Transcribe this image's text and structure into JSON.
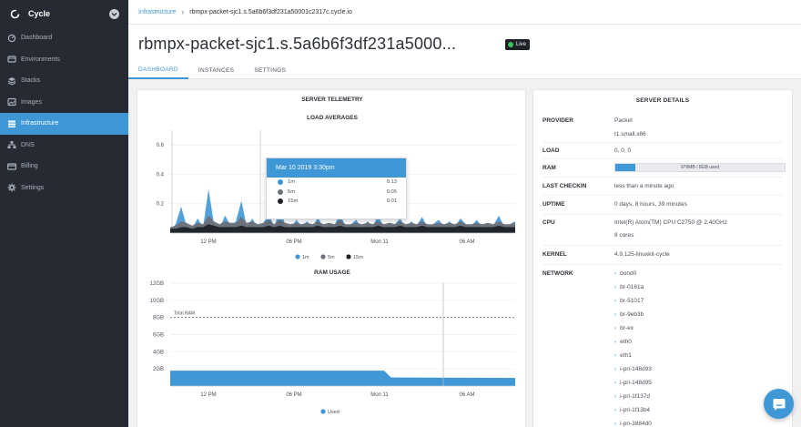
{
  "app": {
    "brand": "Cycle"
  },
  "sidebar": {
    "items": [
      {
        "label": "Dashboard",
        "icon": "dashboard-icon"
      },
      {
        "label": "Environments",
        "icon": "environments-icon"
      },
      {
        "label": "Stacks",
        "icon": "stacks-icon"
      },
      {
        "label": "Images",
        "icon": "images-icon"
      },
      {
        "label": "Infrastructure",
        "icon": "infrastructure-icon",
        "active": true
      },
      {
        "label": "DNS",
        "icon": "dns-icon"
      },
      {
        "label": "Billing",
        "icon": "billing-icon"
      },
      {
        "label": "Settings",
        "icon": "settings-icon"
      }
    ]
  },
  "breadcrumb": {
    "parent": "Infrastructure",
    "current": "rbmpx-packet-sjc1.s.5a6b6f3df231a50001c2317c.cycle.io"
  },
  "header": {
    "title": "rbmpx-packet-sjc1.s.5a6b6f3df231a5000...",
    "badge": "Live"
  },
  "tabs": [
    {
      "label": "DASHBOARD",
      "active": true
    },
    {
      "label": "INSTANCES"
    },
    {
      "label": "SETTINGS"
    }
  ],
  "telemetry": {
    "title": "SERVER TELEMETRY",
    "tooltip": {
      "title": "Mar 10 2019 3:30pm",
      "rows": [
        {
          "label": "1m",
          "value": "0.13",
          "color": "#3f97d6"
        },
        {
          "label": "5m",
          "value": "0.05",
          "color": "#6b7079"
        },
        {
          "label": "15m",
          "value": "0.01",
          "color": "#1e2128"
        }
      ]
    }
  },
  "chart_data": [
    {
      "type": "area",
      "title": "LOAD AVERAGES",
      "x_ticks": [
        "12 PM",
        "06 PM",
        "Mon 11",
        "06 AM"
      ],
      "y_ticks": [
        "0.2",
        "0.4",
        "0.6"
      ],
      "ylim": [
        0,
        0.7
      ],
      "legend": [
        "1m",
        "5m",
        "15m"
      ],
      "legend_position": "bottom",
      "colors": {
        "1m": "#3f97d6",
        "5m": "#6b7079",
        "15m": "#1e2128"
      },
      "series": [
        {
          "name": "1m",
          "values": [
            0.02,
            0.06,
            0.18,
            0.05,
            0.03,
            0.1,
            0.04,
            0.3,
            0.06,
            0.03,
            0.12,
            0.05,
            0.08,
            0.22,
            0.04,
            0.1,
            0.03,
            0.07,
            0.13,
            0.04,
            0.16,
            0.06,
            0.03,
            0.09,
            0.05,
            0.08,
            0.04,
            0.11,
            0.03,
            0.07,
            0.05,
            0.14,
            0.04,
            0.06,
            0.09,
            0.03,
            0.08,
            0.05,
            0.12,
            0.04,
            0.07,
            0.06,
            0.1,
            0.03,
            0.08,
            0.05,
            0.11,
            0.04,
            0.06,
            0.09,
            0.05,
            0.08,
            0.04,
            0.1,
            0.06,
            0.05,
            0.09,
            0.04,
            0.07,
            0.05,
            0.12,
            0.04,
            0.06,
            0.08
          ]
        },
        {
          "name": "5m",
          "values": [
            0.04,
            0.05,
            0.08,
            0.07,
            0.05,
            0.07,
            0.06,
            0.12,
            0.08,
            0.06,
            0.08,
            0.07,
            0.07,
            0.11,
            0.07,
            0.08,
            0.06,
            0.07,
            0.09,
            0.06,
            0.09,
            0.07,
            0.06,
            0.07,
            0.06,
            0.07,
            0.06,
            0.08,
            0.06,
            0.07,
            0.06,
            0.09,
            0.06,
            0.06,
            0.07,
            0.06,
            0.07,
            0.06,
            0.08,
            0.06,
            0.07,
            0.06,
            0.08,
            0.06,
            0.07,
            0.06,
            0.08,
            0.06,
            0.06,
            0.07,
            0.06,
            0.07,
            0.06,
            0.08,
            0.06,
            0.06,
            0.07,
            0.06,
            0.07,
            0.06,
            0.08,
            0.06,
            0.06,
            0.07
          ]
        },
        {
          "name": "15m",
          "values": [
            0.03,
            0.03,
            0.04,
            0.04,
            0.03,
            0.04,
            0.04,
            0.06,
            0.05,
            0.04,
            0.04,
            0.04,
            0.04,
            0.05,
            0.04,
            0.04,
            0.04,
            0.04,
            0.05,
            0.04,
            0.05,
            0.04,
            0.04,
            0.04,
            0.04,
            0.04,
            0.04,
            0.05,
            0.04,
            0.04,
            0.04,
            0.05,
            0.04,
            0.04,
            0.04,
            0.04,
            0.04,
            0.04,
            0.05,
            0.04,
            0.04,
            0.04,
            0.05,
            0.04,
            0.04,
            0.04,
            0.05,
            0.04,
            0.04,
            0.04,
            0.04,
            0.04,
            0.04,
            0.05,
            0.04,
            0.04,
            0.04,
            0.04,
            0.04,
            0.04,
            0.05,
            0.04,
            0.04,
            0.04
          ]
        }
      ]
    },
    {
      "type": "area",
      "title": "RAM USAGE",
      "x_ticks": [
        "12 PM",
        "06 PM",
        "Mon 11",
        "06 AM"
      ],
      "y_ticks": [
        "2GB",
        "4GB",
        "6GB",
        "8GB",
        "10GB",
        "12GB"
      ],
      "ylim": [
        0,
        12
      ],
      "reference_line": {
        "label": "Total RAM",
        "value": 8
      },
      "legend": [
        "Used"
      ],
      "legend_position": "bottom",
      "series": [
        {
          "name": "Used",
          "x": [
            0,
            0.62,
            0.64,
            1
          ],
          "values": [
            1.8,
            1.8,
            1.0,
            0.95
          ]
        }
      ]
    }
  ],
  "details": {
    "title": "SERVER DETAILS",
    "provider_label": "PROVIDER",
    "provider": "Packet",
    "provider_plan": "t1.small.x86",
    "load_label": "LOAD",
    "load": "0, 0, 0",
    "ram_label": "RAM",
    "ram_text": "979MB / 8GB used",
    "ram_fraction": 0.12,
    "last_checkin_label": "LAST CHECKIN",
    "last_checkin": "less than a minute ago",
    "uptime_label": "UPTIME",
    "uptime": "0 days, 8 hours, 39 minutes",
    "cpu_label": "CPU",
    "cpu": "Intel(R) Atom(TM) CPU C2750 @ 2.40GHz",
    "cpu_cores": "8 cores",
    "kernel_label": "KERNEL",
    "kernel": "4.9.125-linuxkit-cycle",
    "network_label": "NETWORK",
    "network": [
      "bond0",
      "br-0161a",
      "br-51017",
      "br-9eb3b",
      "br-ex",
      "eth0",
      "eth1",
      "i-pri-148d93",
      "i-pri-148d95",
      "i-pri-1f137d",
      "i-pri-1f13b4",
      "i-pri-3884d0"
    ]
  }
}
